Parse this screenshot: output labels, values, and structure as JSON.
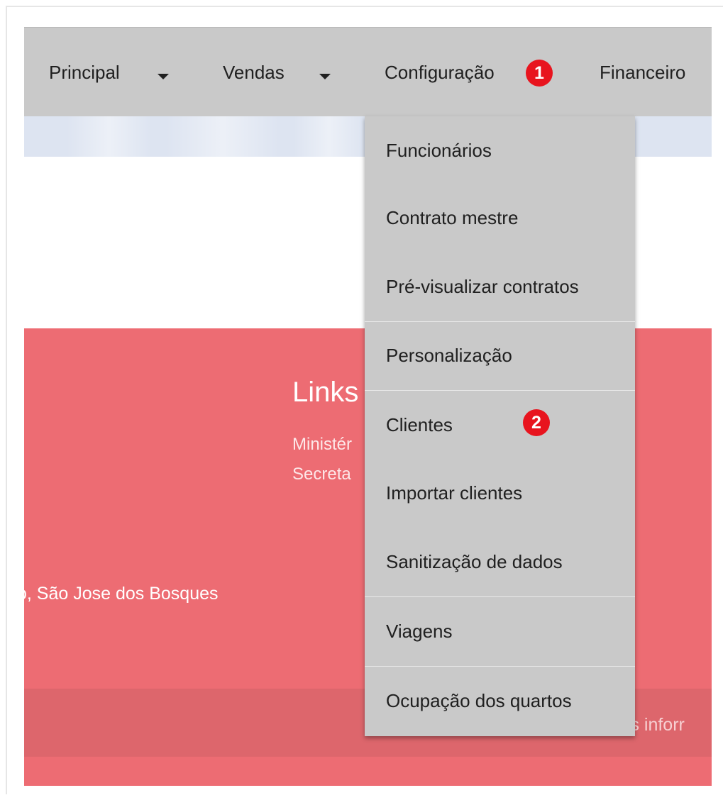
{
  "navbar": {
    "items": [
      {
        "label": "Principal",
        "has_caret": true
      },
      {
        "label": "Vendas",
        "has_caret": true
      },
      {
        "label": "Configuração",
        "has_caret": false
      },
      {
        "label": "Financeiro",
        "has_caret": false
      }
    ],
    "badge_1": "1"
  },
  "dropdown": {
    "items": [
      {
        "label": "Funcionários"
      },
      {
        "label": "Contrato mestre"
      },
      {
        "label": "Pré-visualizar contratos"
      },
      {
        "label": "Personalização"
      },
      {
        "label": "Clientes"
      },
      {
        "label": "Importar clientes"
      },
      {
        "label": "Sanitização de dados"
      },
      {
        "label": "Viagens"
      },
      {
        "label": "Ocupação dos quartos"
      }
    ],
    "badge_2": "2"
  },
  "footer": {
    "links_title": "Links",
    "link_1": "Ministér",
    "link_2": "Secreta",
    "address": "o, São Jose dos Bosques",
    "more_info": "ais inforr"
  },
  "colors": {
    "navbar_bg": "#c9c9c9",
    "badge_red": "#e8141e",
    "footer_red": "#ed6c73",
    "banner_blue": "#dde4f1"
  },
  "icons": [
    "caret-down-icon"
  ]
}
